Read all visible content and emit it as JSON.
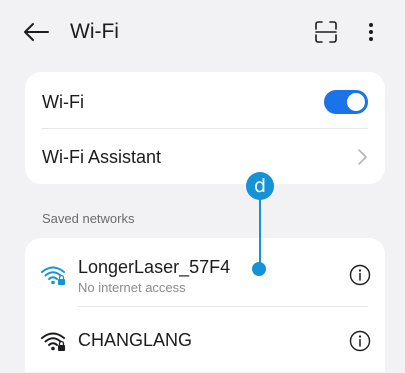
{
  "header": {
    "title": "Wi-Fi",
    "back_icon": "arrow-left-icon",
    "scan_icon": "scan-icon",
    "more_icon": "more-vertical-icon"
  },
  "settings": {
    "wifi_label": "Wi-Fi",
    "wifi_enabled": true,
    "assistant_label": "Wi-Fi Assistant"
  },
  "saved_networks": {
    "section_label": "Saved networks",
    "items": [
      {
        "name": "LongerLaser_57F4",
        "status": "No internet access",
        "icon": "wifi-locked-icon"
      },
      {
        "name": "CHANGLANG",
        "status": "",
        "icon": "wifi-locked-icon"
      }
    ]
  },
  "annotation": {
    "label": "d",
    "color": "#1593d6"
  },
  "colors": {
    "accent": "#1a73e8",
    "background": "#f2f2f4",
    "card": "#ffffff"
  }
}
